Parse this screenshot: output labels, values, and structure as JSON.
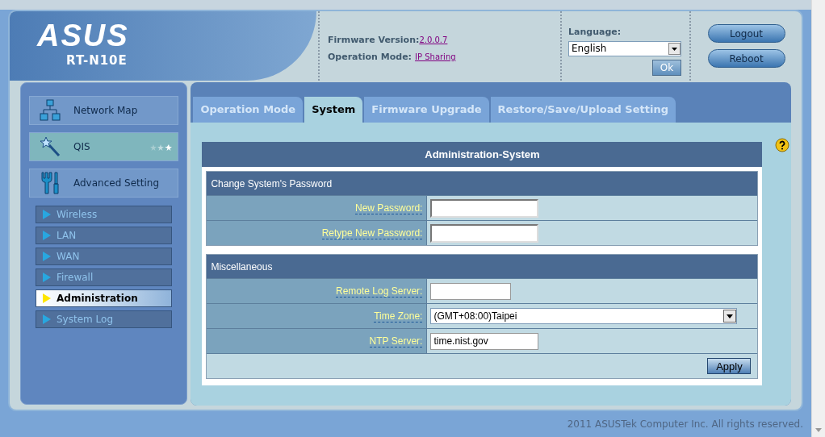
{
  "header": {
    "logo": "ASUS",
    "model": "RT-N10E",
    "firmware_label": "Firmware Version:",
    "firmware_value": "2.0.0.7",
    "mode_label": "Operation Mode:",
    "mode_value": "IP Sharing",
    "language_label": "Language:",
    "language_value": "English",
    "ok_button": "Ok",
    "buttons": [
      "Logout",
      "Reboot"
    ]
  },
  "sidebar": {
    "main_items": [
      {
        "label": "Network Map",
        "kind": "network"
      },
      {
        "label": "QIS",
        "kind": "wizard"
      },
      {
        "label": "Advanced Setting",
        "kind": "tools"
      }
    ],
    "sub_items": [
      {
        "label": "Wireless",
        "selected": false
      },
      {
        "label": "LAN",
        "selected": false
      },
      {
        "label": "WAN",
        "selected": false
      },
      {
        "label": "Firewall",
        "selected": false
      },
      {
        "label": "Administration",
        "selected": true
      },
      {
        "label": "System Log",
        "selected": false
      }
    ]
  },
  "tabs": [
    {
      "label": "Operation Mode",
      "selected": false
    },
    {
      "label": "System",
      "selected": true
    },
    {
      "label": "Firmware Upgrade",
      "selected": false
    },
    {
      "label": "Restore/Save/Upload Setting",
      "selected": false
    }
  ],
  "panel": {
    "title": "Administration-System",
    "sections": [
      {
        "title": "Change System's Password",
        "rows": [
          {
            "label": "New Password:",
            "kind": "password"
          },
          {
            "label": "Retype New Password:",
            "kind": "password"
          }
        ]
      },
      {
        "title": "Miscellaneous",
        "rows": [
          {
            "label": "Remote Log Server:",
            "kind": "text"
          },
          {
            "label": "Time Zone:",
            "kind": "select",
            "value": "(GMT+08:00)Taipei"
          },
          {
            "label": "NTP Server:",
            "kind": "text",
            "value": "time.nist.gov"
          }
        ]
      }
    ],
    "apply_button": "Apply"
  },
  "footer": "2011 ASUSTek Computer Inc. All rights reserved."
}
